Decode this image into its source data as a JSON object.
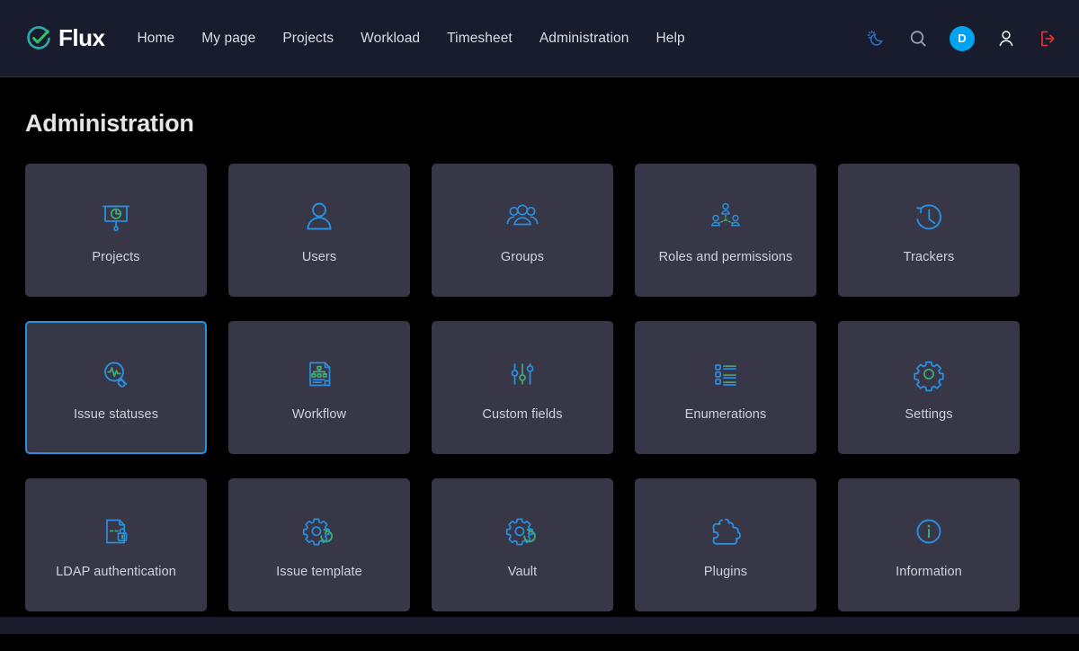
{
  "header": {
    "brand": {
      "name": "Flux",
      "icon": "check-circle-logo"
    },
    "nav": [
      {
        "label": "Home",
        "name": "nav-home"
      },
      {
        "label": "My page",
        "name": "nav-my-page"
      },
      {
        "label": "Projects",
        "name": "nav-projects"
      },
      {
        "label": "Workload",
        "name": "nav-workload"
      },
      {
        "label": "Timesheet",
        "name": "nav-timesheet"
      },
      {
        "label": "Administration",
        "name": "nav-administration"
      },
      {
        "label": "Help",
        "name": "nav-help"
      }
    ],
    "actions": {
      "theme_toggle_icon": "moon-sun-icon",
      "search_icon": "search-icon",
      "avatar_initial": "D",
      "account_icon": "user-icon",
      "logout_icon": "logout-icon"
    }
  },
  "main": {
    "title": "Administration",
    "cards": [
      {
        "label": "Projects",
        "icon": "presentation-chart-icon",
        "selected": false
      },
      {
        "label": "Users",
        "icon": "user-icon",
        "selected": false
      },
      {
        "label": "Groups",
        "icon": "users-group-icon",
        "selected": false
      },
      {
        "label": "Roles and permissions",
        "icon": "hierarchy-users-icon",
        "selected": false
      },
      {
        "label": "Trackers",
        "icon": "clock-arrow-icon",
        "selected": false
      },
      {
        "label": "Issue statuses",
        "icon": "magnifier-pulse-icon",
        "selected": true
      },
      {
        "label": "Workflow",
        "icon": "document-flowchart-icon",
        "selected": false
      },
      {
        "label": "Custom fields",
        "icon": "sliders-icon",
        "selected": false
      },
      {
        "label": "Enumerations",
        "icon": "checklist-icon",
        "selected": false
      },
      {
        "label": "Settings",
        "icon": "gear-icon",
        "selected": false
      },
      {
        "label": "LDAP authentication",
        "icon": "document-lock-icon",
        "selected": false
      },
      {
        "label": "Issue template",
        "icon": "gear-refresh-icon",
        "selected": false
      },
      {
        "label": "Vault",
        "icon": "gear-refresh-icon",
        "selected": false
      },
      {
        "label": "Plugins",
        "icon": "puzzle-piece-icon",
        "selected": false
      },
      {
        "label": "Information",
        "icon": "info-circle-icon",
        "selected": false
      }
    ]
  },
  "colors": {
    "accent_blue": "#2b8ede",
    "accent_green": "#3faa76",
    "avatar_blue": "#00a3f0",
    "logout_red": "#e02d2d",
    "card_bg": "#373748",
    "header_bg": "#191c2c",
    "page_bg": "#000000"
  }
}
